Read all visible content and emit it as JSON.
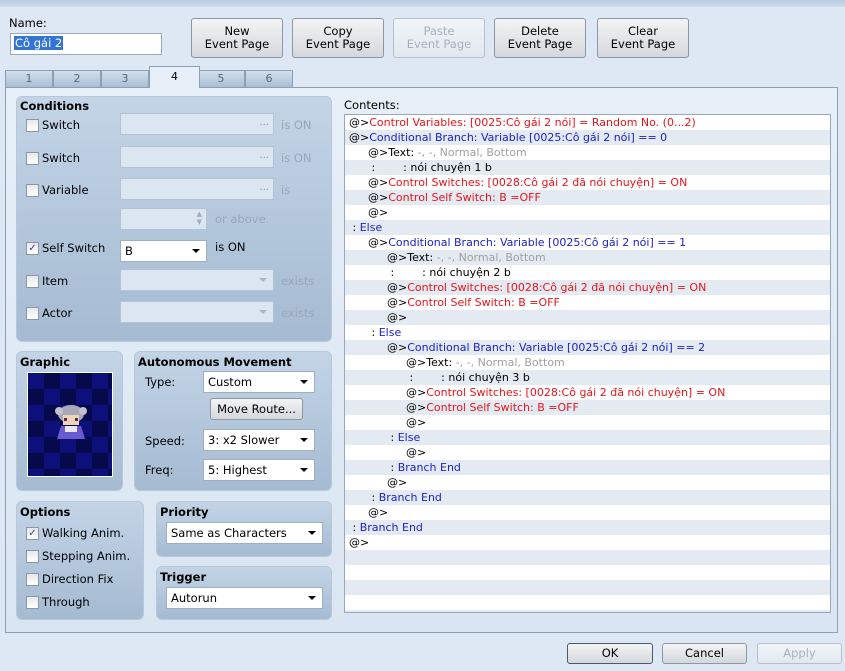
{
  "name": {
    "label": "Name:",
    "value": "Cô gái 2"
  },
  "toolbar": [
    {
      "label1": "New",
      "label2": "Event Page",
      "enabled": true
    },
    {
      "label1": "Copy",
      "label2": "Event Page",
      "enabled": true
    },
    {
      "label1": "Paste",
      "label2": "Event Page",
      "enabled": false
    },
    {
      "label1": "Delete",
      "label2": "Event Page",
      "enabled": true
    },
    {
      "label1": "Clear",
      "label2": "Event Page",
      "enabled": true
    }
  ],
  "tabs": [
    "1",
    "2",
    "3",
    "4",
    "5",
    "6"
  ],
  "active_tab": "4",
  "conditions": {
    "title": "Conditions",
    "switch1": {
      "label": "Switch",
      "checked": false,
      "suffix": "is ON"
    },
    "switch2": {
      "label": "Switch",
      "checked": false,
      "suffix": "is ON"
    },
    "variable": {
      "label": "Variable",
      "checked": false,
      "suffix": "is",
      "or_above": "or above"
    },
    "self_switch": {
      "label": "Self Switch",
      "checked": true,
      "value": "B",
      "suffix": "is ON"
    },
    "item": {
      "label": "Item",
      "checked": false,
      "suffix": "exists"
    },
    "actor": {
      "label": "Actor",
      "checked": false,
      "suffix": "exists"
    }
  },
  "graphic": {
    "title": "Graphic"
  },
  "movement": {
    "title": "Autonomous Movement",
    "type_label": "Type:",
    "type": "Custom",
    "move_route": "Move Route...",
    "speed_label": "Speed:",
    "speed": "3: x2 Slower",
    "freq_label": "Freq:",
    "freq": "5: Highest"
  },
  "options": {
    "title": "Options",
    "items": [
      {
        "label": "Walking Anim.",
        "checked": true
      },
      {
        "label": "Stepping Anim.",
        "checked": false
      },
      {
        "label": "Direction Fix",
        "checked": false
      },
      {
        "label": "Through",
        "checked": false
      }
    ]
  },
  "priority": {
    "title": "Priority",
    "value": "Same as Characters"
  },
  "trigger": {
    "title": "Trigger",
    "value": "Autorun"
  },
  "contents_label": "Contents:",
  "colors": {
    "black": "#000000",
    "red": "#e8141c",
    "blue": "#1c22c8",
    "gray": "#a0a0a0"
  },
  "contents": [
    {
      "i": 0,
      "s": [
        [
          "@>",
          "black"
        ],
        [
          "Control Variables: [0025:Cô gái 2 nói] = Random No. (0...2)",
          "red"
        ]
      ]
    },
    {
      "i": 0,
      "s": [
        [
          "@>",
          "black"
        ],
        [
          "Conditional Branch: Variable [0025:Cô gái 2 nói] == 0",
          "blue"
        ]
      ]
    },
    {
      "i": 1,
      "s": [
        [
          "@>Text: ",
          "black"
        ],
        [
          "-, -, Normal, Bottom",
          "gray"
        ]
      ]
    },
    {
      "i": 1,
      "s": [
        [
          " :        : nói chuyện 1 b",
          "black"
        ]
      ]
    },
    {
      "i": 1,
      "s": [
        [
          "@>",
          "black"
        ],
        [
          "Control Switches: [0028:Cô gái 2 đã nói chuyện] = ON",
          "red"
        ]
      ]
    },
    {
      "i": 1,
      "s": [
        [
          "@>",
          "black"
        ],
        [
          "Control Self Switch: B =OFF",
          "red"
        ]
      ]
    },
    {
      "i": 1,
      "s": [
        [
          "@>",
          "black"
        ]
      ]
    },
    {
      "i": 0,
      "s": [
        [
          " : ",
          "black"
        ],
        [
          "Else",
          "blue"
        ]
      ]
    },
    {
      "i": 1,
      "s": [
        [
          "@>",
          "black"
        ],
        [
          "Conditional Branch: Variable [0025:Cô gái 2 nói] == 1",
          "blue"
        ]
      ]
    },
    {
      "i": 2,
      "s": [
        [
          "@>Text: ",
          "black"
        ],
        [
          "-, -, Normal, Bottom",
          "gray"
        ]
      ]
    },
    {
      "i": 2,
      "s": [
        [
          " :        : nói chuyện 2 b",
          "black"
        ]
      ]
    },
    {
      "i": 2,
      "s": [
        [
          "@>",
          "black"
        ],
        [
          "Control Switches: [0028:Cô gái 2 đã nói chuyện] = ON",
          "red"
        ]
      ]
    },
    {
      "i": 2,
      "s": [
        [
          "@>",
          "black"
        ],
        [
          "Control Self Switch: B =OFF",
          "red"
        ]
      ]
    },
    {
      "i": 2,
      "s": [
        [
          "@>",
          "black"
        ]
      ]
    },
    {
      "i": 1,
      "s": [
        [
          " : ",
          "black"
        ],
        [
          "Else",
          "blue"
        ]
      ]
    },
    {
      "i": 2,
      "s": [
        [
          "@>",
          "black"
        ],
        [
          "Conditional Branch: Variable [0025:Cô gái 2 nói] == 2",
          "blue"
        ]
      ]
    },
    {
      "i": 3,
      "s": [
        [
          "@>Text: ",
          "black"
        ],
        [
          "-, -, Normal, Bottom",
          "gray"
        ]
      ]
    },
    {
      "i": 3,
      "s": [
        [
          " :        : nói chuyện 3 b",
          "black"
        ]
      ]
    },
    {
      "i": 3,
      "s": [
        [
          "@>",
          "black"
        ],
        [
          "Control Switches: [0028:Cô gái 2 đã nói chuyện] = ON",
          "red"
        ]
      ]
    },
    {
      "i": 3,
      "s": [
        [
          "@>",
          "black"
        ],
        [
          "Control Self Switch: B =OFF",
          "red"
        ]
      ]
    },
    {
      "i": 3,
      "s": [
        [
          "@>",
          "black"
        ]
      ]
    },
    {
      "i": 2,
      "s": [
        [
          " : ",
          "black"
        ],
        [
          "Else",
          "blue"
        ]
      ]
    },
    {
      "i": 3,
      "s": [
        [
          "@>",
          "black"
        ]
      ]
    },
    {
      "i": 2,
      "s": [
        [
          " : ",
          "black"
        ],
        [
          "Branch End",
          "blue"
        ]
      ]
    },
    {
      "i": 2,
      "s": [
        [
          "@>",
          "black"
        ]
      ]
    },
    {
      "i": 1,
      "s": [
        [
          " : ",
          "black"
        ],
        [
          "Branch End",
          "blue"
        ]
      ]
    },
    {
      "i": 1,
      "s": [
        [
          "@>",
          "black"
        ]
      ]
    },
    {
      "i": 0,
      "s": [
        [
          " : ",
          "black"
        ],
        [
          "Branch End",
          "blue"
        ]
      ]
    },
    {
      "i": 0,
      "s": [
        [
          "@>",
          "black"
        ]
      ]
    }
  ],
  "footer": {
    "ok": "OK",
    "cancel": "Cancel",
    "apply": "Apply"
  }
}
